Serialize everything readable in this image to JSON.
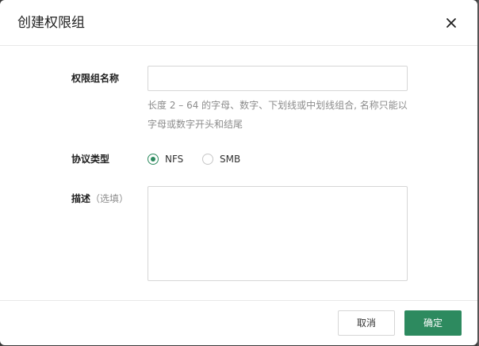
{
  "dialog": {
    "title": "创建权限组",
    "close_icon": "close-icon"
  },
  "form": {
    "name_label": "权限组名称",
    "name_value": "",
    "name_placeholder": "",
    "name_hint": "长度 2 – 64 的字母、数字、下划线或中划线组合, 名称只能以字母或数字开头和结尾",
    "protocol_label": "协议类型",
    "protocol_options": [
      {
        "label": "NFS",
        "selected": true
      },
      {
        "label": "SMB",
        "selected": false
      }
    ],
    "description_label": "描述",
    "description_optional": "（选填）",
    "description_value": ""
  },
  "footer": {
    "cancel_label": "取消",
    "ok_label": "确定"
  },
  "colors": {
    "accent": "#2d8a5f",
    "border": "#d6d6d6",
    "hint": "#8c8c8c"
  }
}
